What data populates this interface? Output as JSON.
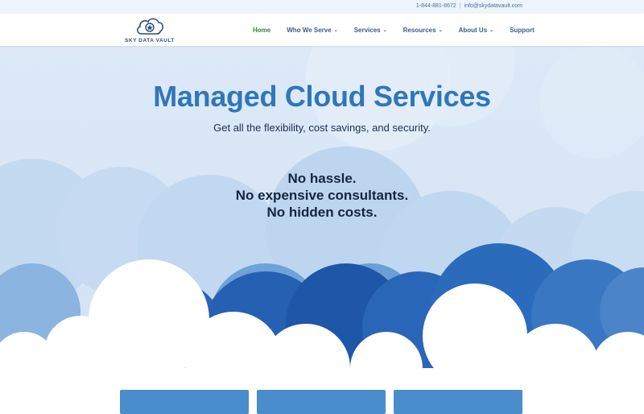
{
  "topbar": {
    "phone": "1-844-881-8672",
    "email": "info@skydatavault.com"
  },
  "logo": {
    "text": "SKY DATA VAULT"
  },
  "nav": {
    "items": [
      {
        "label": "Home",
        "active": true,
        "dropdown": false
      },
      {
        "label": "Who We Serve",
        "active": false,
        "dropdown": true
      },
      {
        "label": "Services",
        "active": false,
        "dropdown": true
      },
      {
        "label": "Resources",
        "active": false,
        "dropdown": true
      },
      {
        "label": "About Us",
        "active": false,
        "dropdown": true
      },
      {
        "label": "Support",
        "active": false,
        "dropdown": false
      }
    ]
  },
  "hero": {
    "title": "Managed Cloud Services",
    "subtitle": "Get all the flexibility, cost savings, and security.",
    "points": [
      "No hassle.",
      "No expensive consultants.",
      "No hidden costs."
    ]
  },
  "colors": {
    "accent": "#2f77b9",
    "nav_active": "#2f8a3f",
    "card": "#4a8dcc",
    "cloud_dark": "#1e56a8"
  }
}
